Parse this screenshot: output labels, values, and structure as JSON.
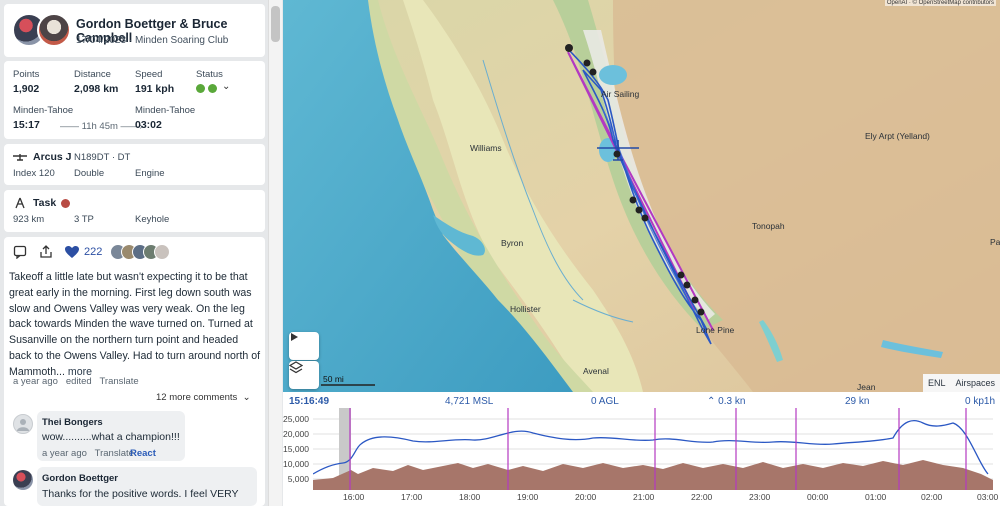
{
  "header": {
    "pilots": "Gordon Boettger & Bruce Campbell",
    "date": "17/04/2023",
    "club": "Minden Soaring Club"
  },
  "stats": {
    "points_label": "Points",
    "points": "1,902",
    "distance_label": "Distance",
    "distance": "2,098 km",
    "speed_label": "Speed",
    "speed": "191 kph",
    "status_label": "Status",
    "status_colors": [
      "#5aa83a",
      "#5aa83a"
    ],
    "takeoff_place": "Minden-Tahoe",
    "takeoff_time": "15:17",
    "duration": "11h 45m",
    "landing_place": "Minden-Tahoe",
    "landing_time": "03:02"
  },
  "glider": {
    "icon": "glider-icon",
    "model": "Arcus J",
    "reg": "N189DT",
    "cn": "DT",
    "index": "Index 120",
    "seats": "Double",
    "engine": "Engine"
  },
  "task": {
    "icon": "compass-icon",
    "label": "Task",
    "status_color": "#b84b44",
    "distance": "923 km",
    "turnpoints": "3 TP",
    "type": "Keyhole"
  },
  "social": {
    "likes": "222",
    "story": "Takeoff a little late but wasn't expecting it to be that great early in the morning. First leg down south was slow and Owens Valley was very weak. On the leg back towards Minden the wave turned on. Turned at Susanville on the northern turn point and headed back to the Owens Valley. Had to turn around north of Mammoth...",
    "more": "more",
    "posted": "a year ago",
    "edited": "edited",
    "translate": "Translate",
    "more_comments": "12 more comments"
  },
  "comments": [
    {
      "name": "Thei Bongers",
      "text": "wow..........what a champion!!!",
      "time": "a year ago",
      "translate": "Translate",
      "react": "React"
    },
    {
      "name": "Gordon Boettger",
      "text": "Thanks for the positive words.  I feel VERY"
    }
  ],
  "map": {
    "attribution": "OpenAI · © OpenStreetMap contributors",
    "places": [
      "Air Sailing",
      "Williams",
      "Ely Arpt (Yelland)",
      "Byron",
      "Tonopah",
      "Hollister",
      "Lone Pine",
      "Avenal",
      "Jean",
      "Pa"
    ],
    "scale": "50 mi",
    "tabs": [
      "ENL",
      "Airspaces"
    ]
  },
  "barogram": {
    "time": "15:16:49",
    "altitude": "4,721 MSL",
    "agl": "0 AGL",
    "vario": "0.3 kn",
    "speed": "29 kn",
    "ld": "0 kp1h",
    "y_ticks": [
      "25,000",
      "20,000",
      "15,000",
      "10,000",
      "5,000"
    ],
    "x_ticks": [
      "16:00",
      "17:00",
      "18:00",
      "19:00",
      "20:00",
      "21:00",
      "22:00",
      "23:00",
      "00:00",
      "01:00",
      "02:00",
      "03:00"
    ]
  }
}
